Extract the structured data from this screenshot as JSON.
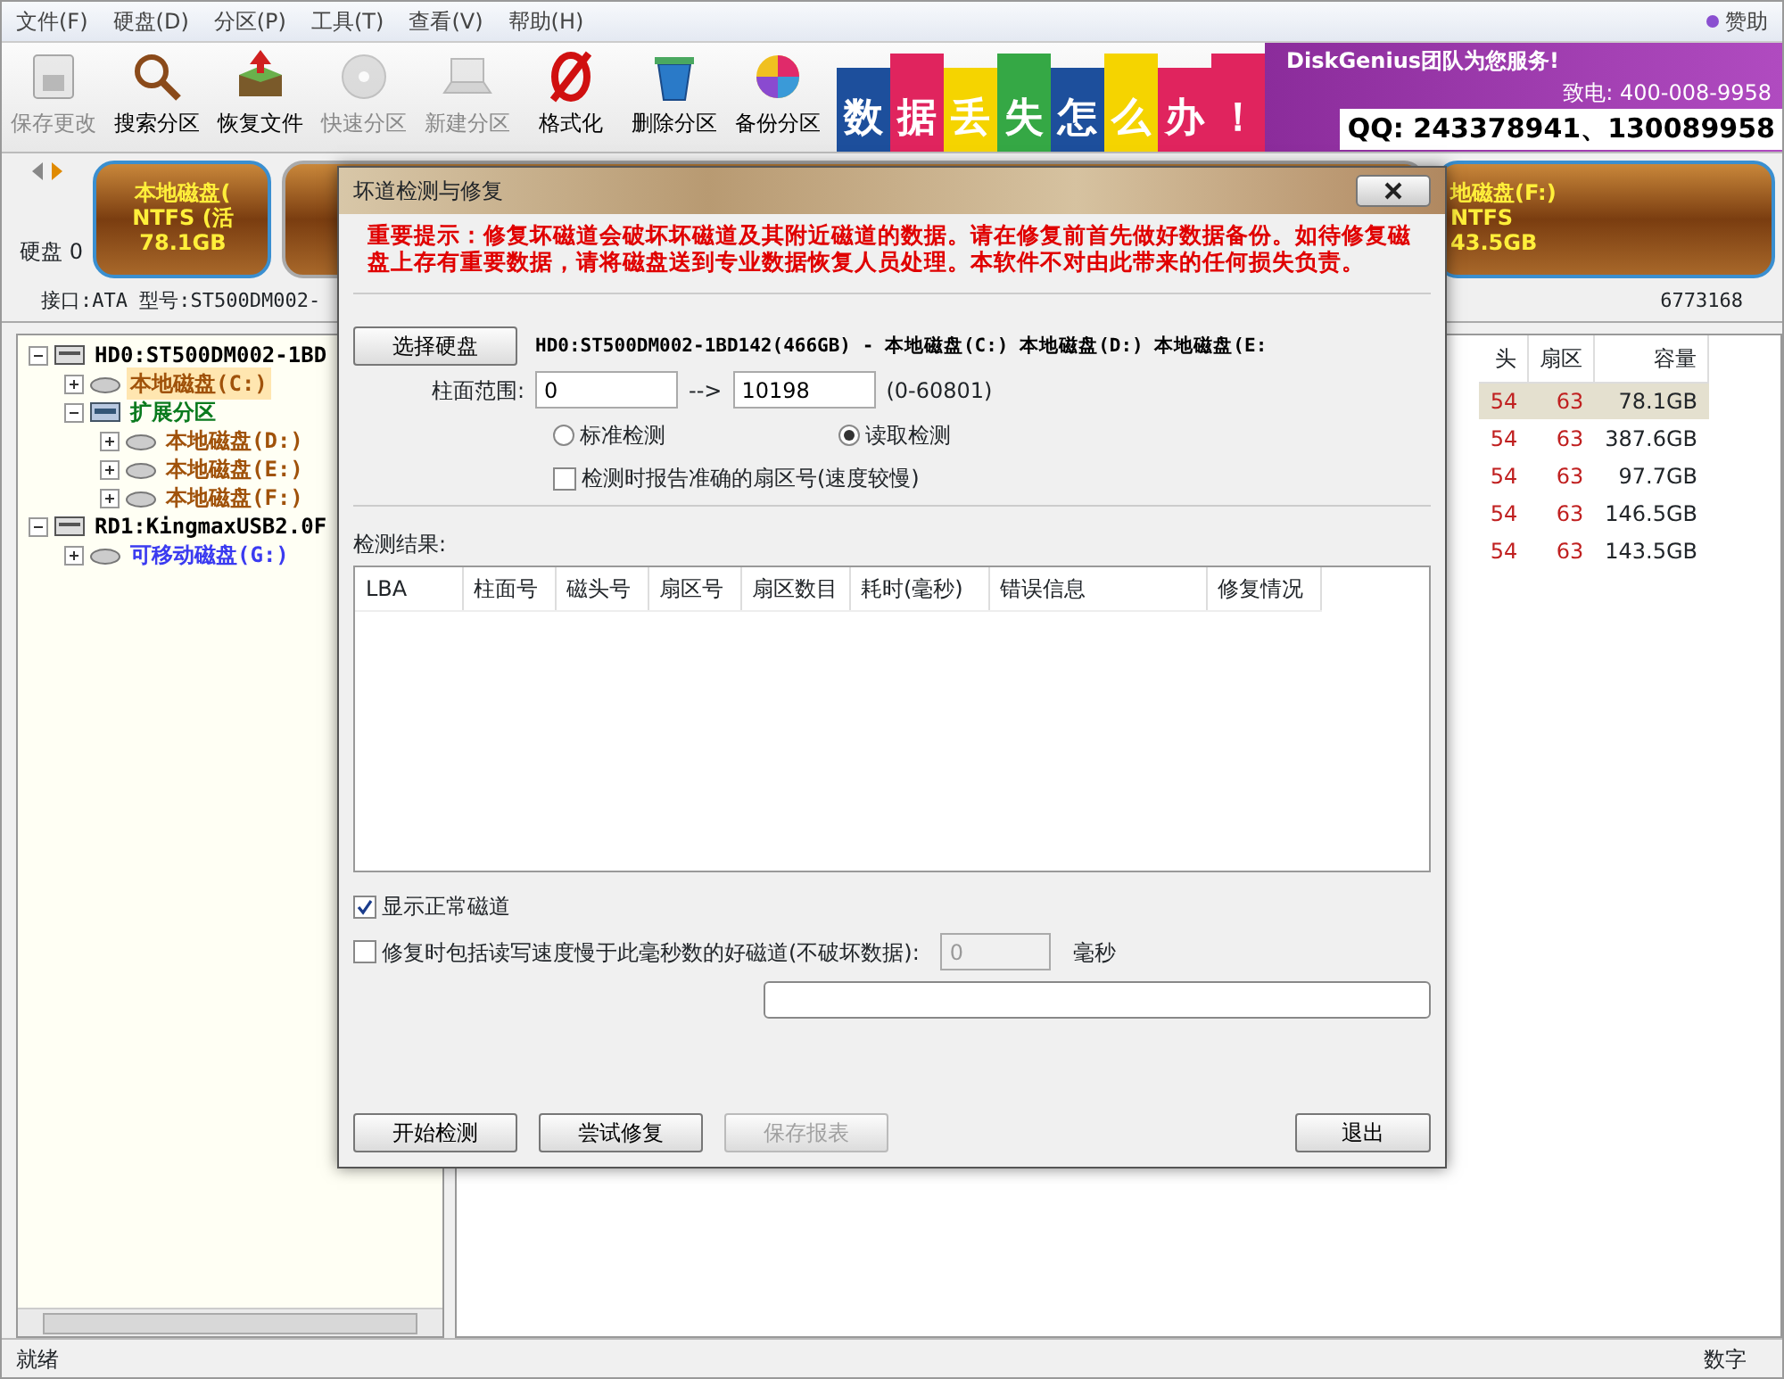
{
  "menu": [
    {
      "label": "文件(F)"
    },
    {
      "label": "硬盘(D)"
    },
    {
      "label": "分区(P)"
    },
    {
      "label": "工具(T)"
    },
    {
      "label": "查看(V)"
    },
    {
      "label": "帮助(H)"
    }
  ],
  "sponsor": {
    "label": "赞助"
  },
  "toolbar": [
    {
      "kind": "save",
      "label": "保存更改",
      "disabled": true
    },
    {
      "kind": "search",
      "label": "搜索分区",
      "disabled": false
    },
    {
      "kind": "restore",
      "label": "恢复文件",
      "disabled": false
    },
    {
      "kind": "quick",
      "label": "快速分区",
      "disabled": true
    },
    {
      "kind": "new",
      "label": "新建分区",
      "disabled": true
    },
    {
      "kind": "format",
      "label": "格式化",
      "disabled": false
    },
    {
      "kind": "delete",
      "label": "删除分区",
      "disabled": false
    },
    {
      "kind": "backup",
      "label": "备份分区",
      "disabled": false
    }
  ],
  "banner": {
    "tiles": [
      {
        "text": "数",
        "color": "#1d4f9c"
      },
      {
        "text": "据",
        "color": "#e0245e"
      },
      {
        "text": "丢",
        "color": "#f5d400"
      },
      {
        "text": "失",
        "color": "#35a845"
      },
      {
        "text": "怎",
        "color": "#1d4f9c"
      },
      {
        "text": "么",
        "color": "#f5d400"
      },
      {
        "text": "办",
        "color": "#e0245e"
      },
      {
        "text": "！",
        "color": "#e0245e"
      }
    ],
    "team": "DiskGenius团队为您服务!",
    "phone": "致电: 400-008-9958",
    "qq": "QQ: 243378941、130089958"
  },
  "disk_map": {
    "disk_label": "硬盘 0",
    "left_segment": [
      "本地磁盘(",
      "NTFS (活",
      "78.1GB"
    ],
    "right_segment": [
      "地磁盘(F:)",
      "NTFS",
      "43.5GB"
    ],
    "info": "接口:ATA  型号:ST500DM002-",
    "info_tail": "6773168"
  },
  "tree": [
    {
      "kind": "disk",
      "label": "HD0:ST500DM002-1BD",
      "expanded": true,
      "selected": false,
      "color": "#000000",
      "children": [
        {
          "kind": "partition",
          "label": "本地磁盘(C:)",
          "expanded": false,
          "selected": true,
          "color": "#a0520a"
        },
        {
          "kind": "extended",
          "label": "扩展分区",
          "expanded": true,
          "selected": false,
          "color": "#0a7a1e",
          "children": [
            {
              "kind": "partition",
              "label": "本地磁盘(D:)",
              "expanded": false,
              "selected": false,
              "color": "#a0520a"
            },
            {
              "kind": "partition",
              "label": "本地磁盘(E:)",
              "expanded": false,
              "selected": false,
              "color": "#a0520a"
            },
            {
              "kind": "partition",
              "label": "本地磁盘(F:)",
              "expanded": false,
              "selected": false,
              "color": "#a0520a"
            }
          ]
        }
      ]
    },
    {
      "kind": "disk",
      "label": "RD1:KingmaxUSB2.0F",
      "expanded": true,
      "selected": false,
      "color": "#000000",
      "children": [
        {
          "kind": "partition",
          "label": "可移动磁盘(G:)",
          "expanded": false,
          "selected": false,
          "color": "#3b3bf0"
        }
      ]
    }
  ],
  "partition_table": {
    "columns": [
      "头",
      "扇区",
      "容量"
    ],
    "rows": [
      {
        "cells": [
          "54",
          "63",
          "78.1GB"
        ],
        "selected": true
      },
      {
        "cells": [
          "54",
          "63",
          "387.6GB"
        ],
        "selected": false
      },
      {
        "cells": [
          "54",
          "63",
          "97.7GB"
        ],
        "selected": false
      },
      {
        "cells": [
          "54",
          "63",
          "146.5GB"
        ],
        "selected": false
      },
      {
        "cells": [
          "54",
          "63",
          "143.5GB"
        ],
        "selected": false
      }
    ]
  },
  "status_bar": {
    "left": "就绪",
    "right": "数字"
  },
  "dialog": {
    "title": "坏道检测与修复",
    "warning": "重要提示：修复坏磁道会破坏坏磁道及其附近磁道的数据。请在修复前首先做好数据备份。如待修复磁盘上存有重要数据，请将磁盘送到专业数据恢复人员处理。本软件不对由此带来的任何损失负责。",
    "select_button": "选择硬盘",
    "disk_value": "HD0:ST500DM002-1BD142(466GB) - 本地磁盘(C:) 本地磁盘(D:) 本地磁盘(E:",
    "range_label": "柱面范围:",
    "range_from": "0",
    "range_arrow": "-->",
    "range_to": "10198",
    "range_hint": "(0-60801)",
    "modes": [
      {
        "label": "标准检测",
        "selected": false
      },
      {
        "label": "读取检测",
        "selected": true
      }
    ],
    "exact_sector": {
      "label": "检测时报告准确的扇区号(速度较慢)",
      "checked": false
    },
    "results_label": "检测结果:",
    "columns": [
      "LBA",
      "柱面号",
      "磁头号",
      "扇区号",
      "扇区数目",
      "耗时(毫秒)",
      "错误信息",
      "修复情况"
    ],
    "show_normal": {
      "label": "显示正常磁道",
      "checked": true
    },
    "slow_repair": {
      "label": "修复时包括读写速度慢于此毫秒数的好磁道(不破坏数据):",
      "checked": false,
      "value": "0",
      "unit": "毫秒"
    },
    "progress": {
      "level": 0
    },
    "buttons": [
      {
        "label": "开始检测",
        "disabled": false
      },
      {
        "label": "尝试修复",
        "disabled": false
      },
      {
        "label": "保存报表",
        "disabled": true
      },
      {
        "label": "退出",
        "disabled": false
      }
    ]
  }
}
